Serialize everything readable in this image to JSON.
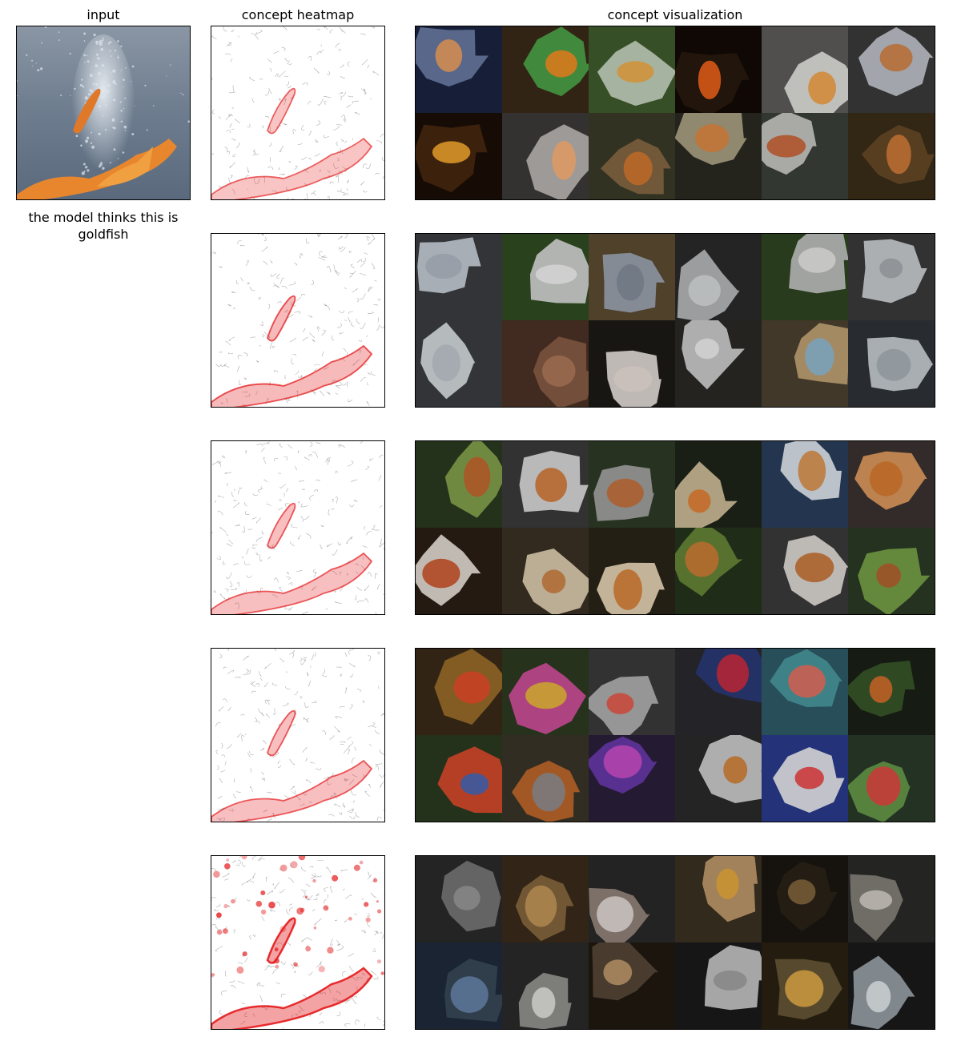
{
  "headers": {
    "input": "input",
    "heatmap": "concept heatmap",
    "visualization": "concept visualization"
  },
  "caption": "the model thinks this is goldfish",
  "colors": {
    "heat": "#e41a1c",
    "contour": "#9a9a9a",
    "frame": "#000000"
  },
  "concepts": [
    {
      "heat_intensity": 0.45,
      "tiles": [
        {
          "bg": "#1b2440",
          "fg": "#f3a15a",
          "mask": "#6e7fa8"
        },
        {
          "bg": "#3a2a18",
          "fg": "#ff8a1e",
          "mask": "#4ea84a"
        },
        {
          "bg": "#3f5a2c",
          "fg": "#f0a640",
          "mask": "#cbd8c6"
        },
        {
          "bg": "#120a06",
          "fg": "#ff6a1c",
          "mask": "#2a1a10"
        },
        {
          "bg": "#5c5a58",
          "fg": "#f09a3a",
          "mask": "#e8e8e6"
        },
        {
          "bg": "#3a3a3a",
          "fg": "#d07a3a",
          "mask": "#c8cbd4"
        },
        {
          "bg": "#1a0e06",
          "fg": "#ffb030",
          "mask": "#4a2a10"
        },
        {
          "bg": "#3c3a38",
          "fg": "#ffb070",
          "mask": "#c0beba"
        },
        {
          "bg": "#3a3a28",
          "fg": "#d9782e",
          "mask": "#8a6a44"
        },
        {
          "bg": "#2a2a20",
          "fg": "#e0843a",
          "mask": "#b4a88a"
        },
        {
          "bg": "#3a4038",
          "fg": "#c85a2a",
          "mask": "#d0d0cc"
        },
        {
          "bg": "#3a2c18",
          "fg": "#d7803a",
          "mask": "#6a4a28"
        }
      ]
    },
    {
      "heat_intensity": 0.6,
      "tiles": [
        {
          "bg": "#3a3c40",
          "fg": "#a9b2bd",
          "mask": "#cfd6de"
        },
        {
          "bg": "#2f4a22",
          "fg": "#f1f1f1",
          "mask": "#dcdcdc"
        },
        {
          "bg": "#5a4a30",
          "fg": "#7e8796",
          "mask": "#9fa9b8"
        },
        {
          "bg": "#2a2a2a",
          "fg": "#d8dadc",
          "mask": "#c0c2c4"
        },
        {
          "bg": "#2e4420",
          "fg": "#e8e8e8",
          "mask": "#c8c8c8"
        },
        {
          "bg": "#3a3a3a",
          "fg": "#a0a4aa",
          "mask": "#d4d8dc"
        },
        {
          "bg": "#3a3c40",
          "fg": "#b8c0c8",
          "mask": "#e0e4e8"
        },
        {
          "bg": "#4a3024",
          "fg": "#b07a5a",
          "mask": "#8a5e46"
        },
        {
          "bg": "#1c1a16",
          "fg": "#e8dcd6",
          "mask": "#f0e8e4"
        },
        {
          "bg": "#2a2824",
          "fg": "#f0f0f0",
          "mask": "#d8d8d8"
        },
        {
          "bg": "#4a4030",
          "fg": "#88b8d8",
          "mask": "#c8a878"
        },
        {
          "bg": "#2e3236",
          "fg": "#a0a8b0",
          "mask": "#d0d6dc"
        }
      ]
    },
    {
      "heat_intensity": 0.5,
      "tiles": [
        {
          "bg": "#2a3a20",
          "fg": "#c8602a",
          "mask": "#8aa850"
        },
        {
          "bg": "#3a3a3a",
          "fg": "#d0702c",
          "mask": "#e4e4e4"
        },
        {
          "bg": "#2e3a26",
          "fg": "#c86a30",
          "mask": "#a8a8a8"
        },
        {
          "bg": "#1e2418",
          "fg": "#e0782a",
          "mask": "#d8c8a0"
        },
        {
          "bg": "#2a3e5a",
          "fg": "#d88a40",
          "mask": "#e8eef4"
        },
        {
          "bg": "#3a3230",
          "fg": "#d4762a",
          "mask": "#e8a060"
        },
        {
          "bg": "#2a1e14",
          "fg": "#c84a1e",
          "mask": "#f0e8e0"
        },
        {
          "bg": "#3a3024",
          "fg": "#c8783a",
          "mask": "#e8d8b8"
        },
        {
          "bg": "#2a2418",
          "fg": "#d4782c",
          "mask": "#f2e0c0"
        },
        {
          "bg": "#24341c",
          "fg": "#d47a34",
          "mask": "#6a8a3a"
        },
        {
          "bg": "#3a3a3a",
          "fg": "#c46a2a",
          "mask": "#eae6e0"
        },
        {
          "bg": "#2a3a24",
          "fg": "#b85a2a",
          "mask": "#7aa84a"
        }
      ]
    },
    {
      "heat_intensity": 0.5,
      "tiles": [
        {
          "bg": "#3a2a18",
          "fg": "#e84a2a",
          "mask": "#a0702a"
        },
        {
          "bg": "#2c3a20",
          "fg": "#e8c030",
          "mask": "#d850a0"
        },
        {
          "bg": "#3a3a3a",
          "fg": "#e85040",
          "mask": "#b8b8b8"
        },
        {
          "bg": "#2a2a2e",
          "fg": "#d42a3a",
          "mask": "#2a3a7a"
        },
        {
          "bg": "#2e5a66",
          "fg": "#f06a5a",
          "mask": "#4a9aa0"
        },
        {
          "bg": "#1a2016",
          "fg": "#e0702a",
          "mask": "#3a5a2a"
        },
        {
          "bg": "#2a3a20",
          "fg": "#3a6ac0",
          "mask": "#e04a2a"
        },
        {
          "bg": "#3a3428",
          "fg": "#8a8e96",
          "mask": "#c86a2a"
        },
        {
          "bg": "#2a1e3a",
          "fg": "#d050c8",
          "mask": "#6a3ab0"
        },
        {
          "bg": "#2a2a2a",
          "fg": "#d0782a",
          "mask": "#d8d8d8"
        },
        {
          "bg": "#2a3a8a",
          "fg": "#e83a3a",
          "mask": "#f0f0f0"
        },
        {
          "bg": "#2a3a2a",
          "fg": "#e84040",
          "mask": "#6aa04a"
        }
      ]
    },
    {
      "heat_intensity": 1.0,
      "tiles": [
        {
          "bg": "#2a2a2a",
          "fg": "#9a9a9a",
          "mask": "#7a7a7a"
        },
        {
          "bg": "#3a2a1a",
          "fg": "#c89a5a",
          "mask": "#8a6a40"
        },
        {
          "bg": "#2a2828",
          "fg": "#e8e0dc",
          "mask": "#9a8a80"
        },
        {
          "bg": "#3a3020",
          "fg": "#e8a838",
          "mask": "#c8a070"
        },
        {
          "bg": "#1a1610",
          "fg": "#8a6a40",
          "mask": "#2a2418"
        },
        {
          "bg": "#2a2a28",
          "fg": "#d8d4cc",
          "mask": "#8a867e"
        },
        {
          "bg": "#1e2a3a",
          "fg": "#6a8ab0",
          "mask": "#3a4a5a"
        },
        {
          "bg": "#2a2a2a",
          "fg": "#e8e8e4",
          "mask": "#9a9a96"
        },
        {
          "bg": "#201810",
          "fg": "#c8a070",
          "mask": "#5a4a3a"
        },
        {
          "bg": "#1a1a1a",
          "fg": "#9a9a9a",
          "mask": "#d0d0d0"
        },
        {
          "bg": "#2a2010",
          "fg": "#e8b048",
          "mask": "#6a5a3a"
        },
        {
          "bg": "#1a1a1a",
          "fg": "#e8eef0",
          "mask": "#a0a8b0"
        }
      ]
    }
  ]
}
